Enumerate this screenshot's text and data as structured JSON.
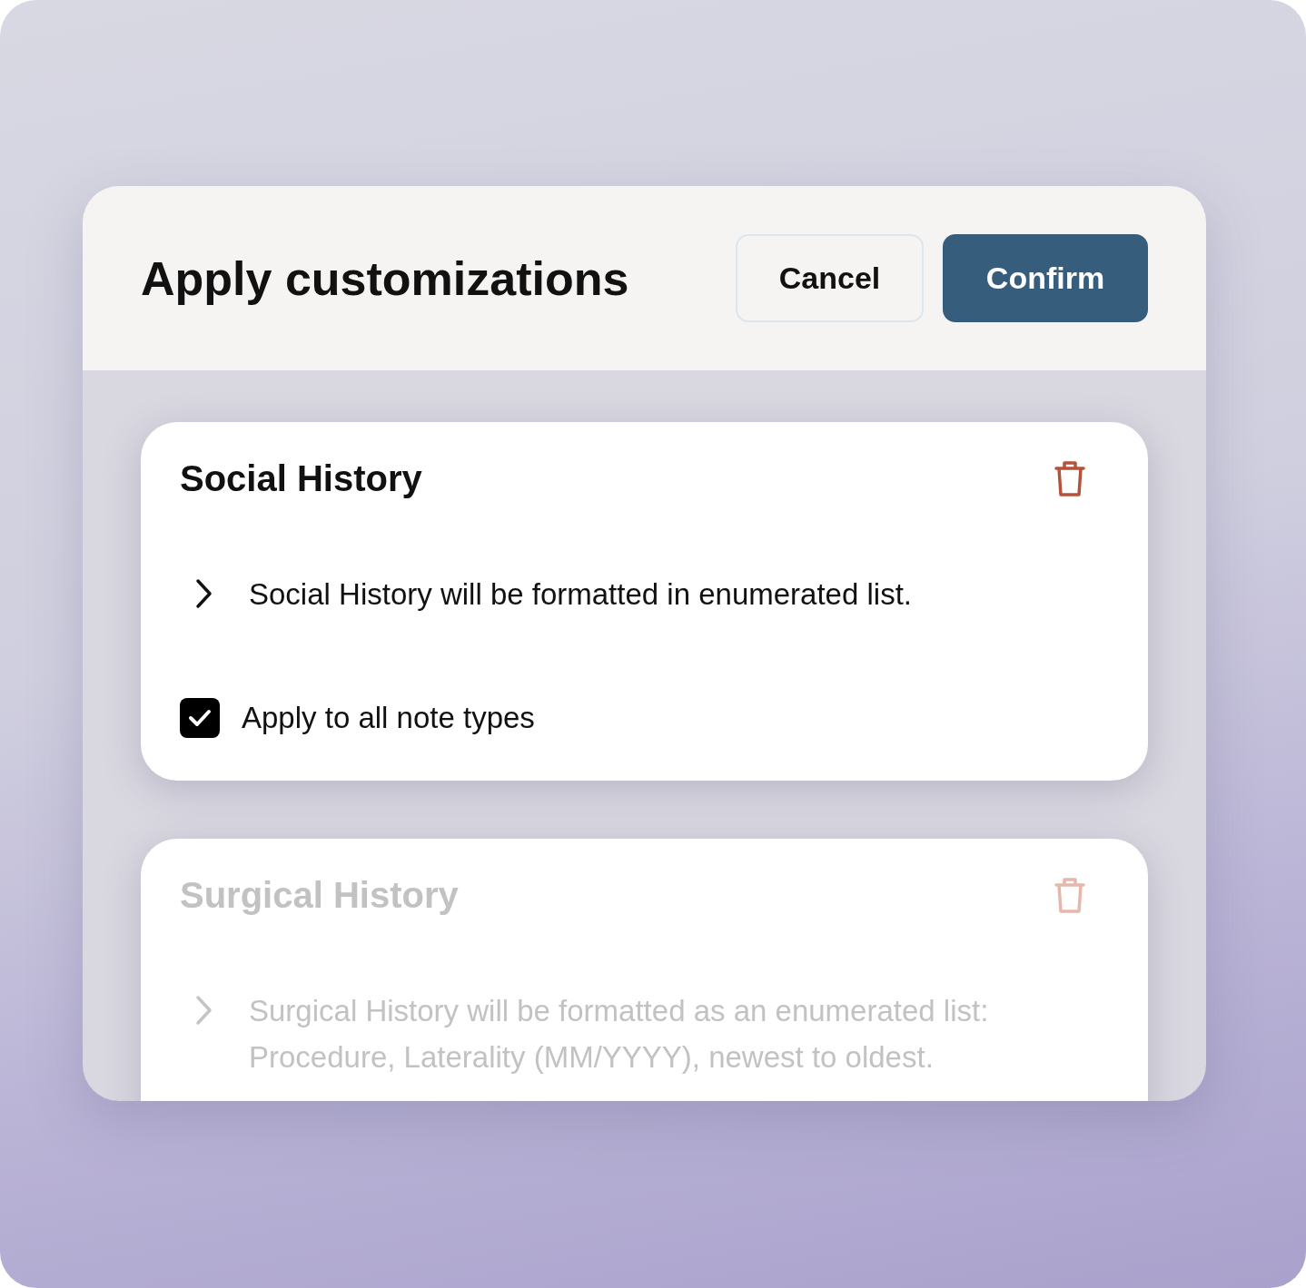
{
  "dialog": {
    "title": "Apply customizations",
    "buttons": [
      {
        "label": "Cancel",
        "kind": "secondary"
      },
      {
        "label": "Confirm",
        "kind": "primary"
      }
    ]
  },
  "cards": [
    {
      "title": "Social History",
      "description": "Social History will be formatted in enumerated list.",
      "disabled": false,
      "checkbox": {
        "label": "Apply to all note types",
        "checked": true
      }
    },
    {
      "title": "Surgical History",
      "description": "Surgical History will be formatted as an enumerated list: Procedure, Laterality (MM/YYYY), newest to oldest.",
      "disabled": true
    }
  ]
}
